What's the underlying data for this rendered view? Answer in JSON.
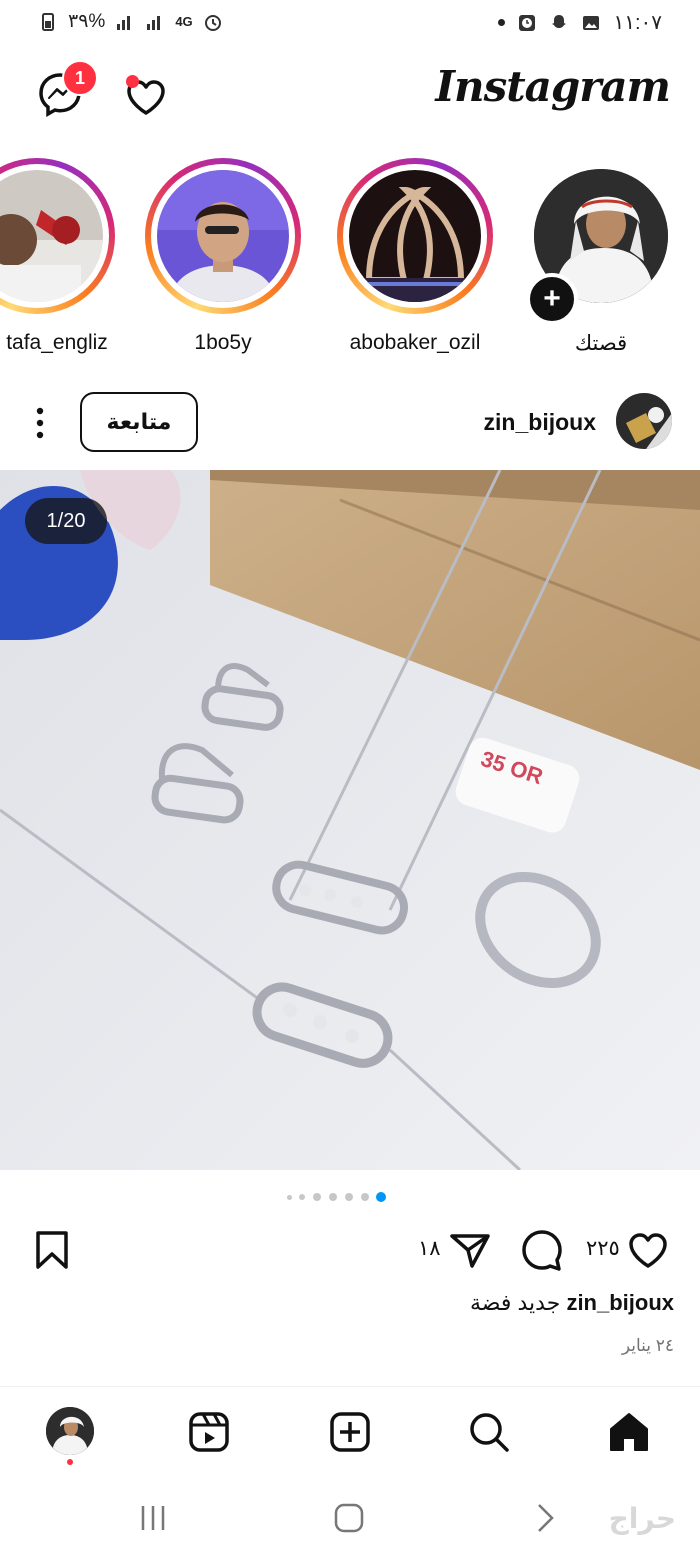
{
  "status_bar": {
    "left_text": "٣٩%",
    "network": "4G",
    "time": "١١:٠٧"
  },
  "header": {
    "logo": "Instagram",
    "messenger_badge": "1"
  },
  "stories": [
    {
      "username": "tafa_engliz"
    },
    {
      "username": "1bo5y"
    },
    {
      "username": "abobaker_ozil"
    },
    {
      "username": "قصتك",
      "own": true
    }
  ],
  "post": {
    "username": "zin_bijoux",
    "follow_label": "متابعة",
    "counter": "1/20",
    "price_tag": "35 OR",
    "likes": "٢٢٥",
    "shares": "١٨",
    "caption_user": "zin_bijoux",
    "caption_text": "جديد فضة",
    "date": "٢٤ يناير",
    "carousel_dots": 7,
    "active_dot": 6
  },
  "colors": {
    "accent_red": "#ff3040",
    "active_blue": "#0095f6",
    "text": "#111111",
    "muted": "#737373"
  },
  "icons": [
    "messenger-icon",
    "heart-icon",
    "more-icon",
    "bookmark-icon",
    "send-icon",
    "comment-icon",
    "like-icon",
    "reels-icon",
    "create-icon",
    "search-icon",
    "home-icon"
  ],
  "watermark": "حراج"
}
